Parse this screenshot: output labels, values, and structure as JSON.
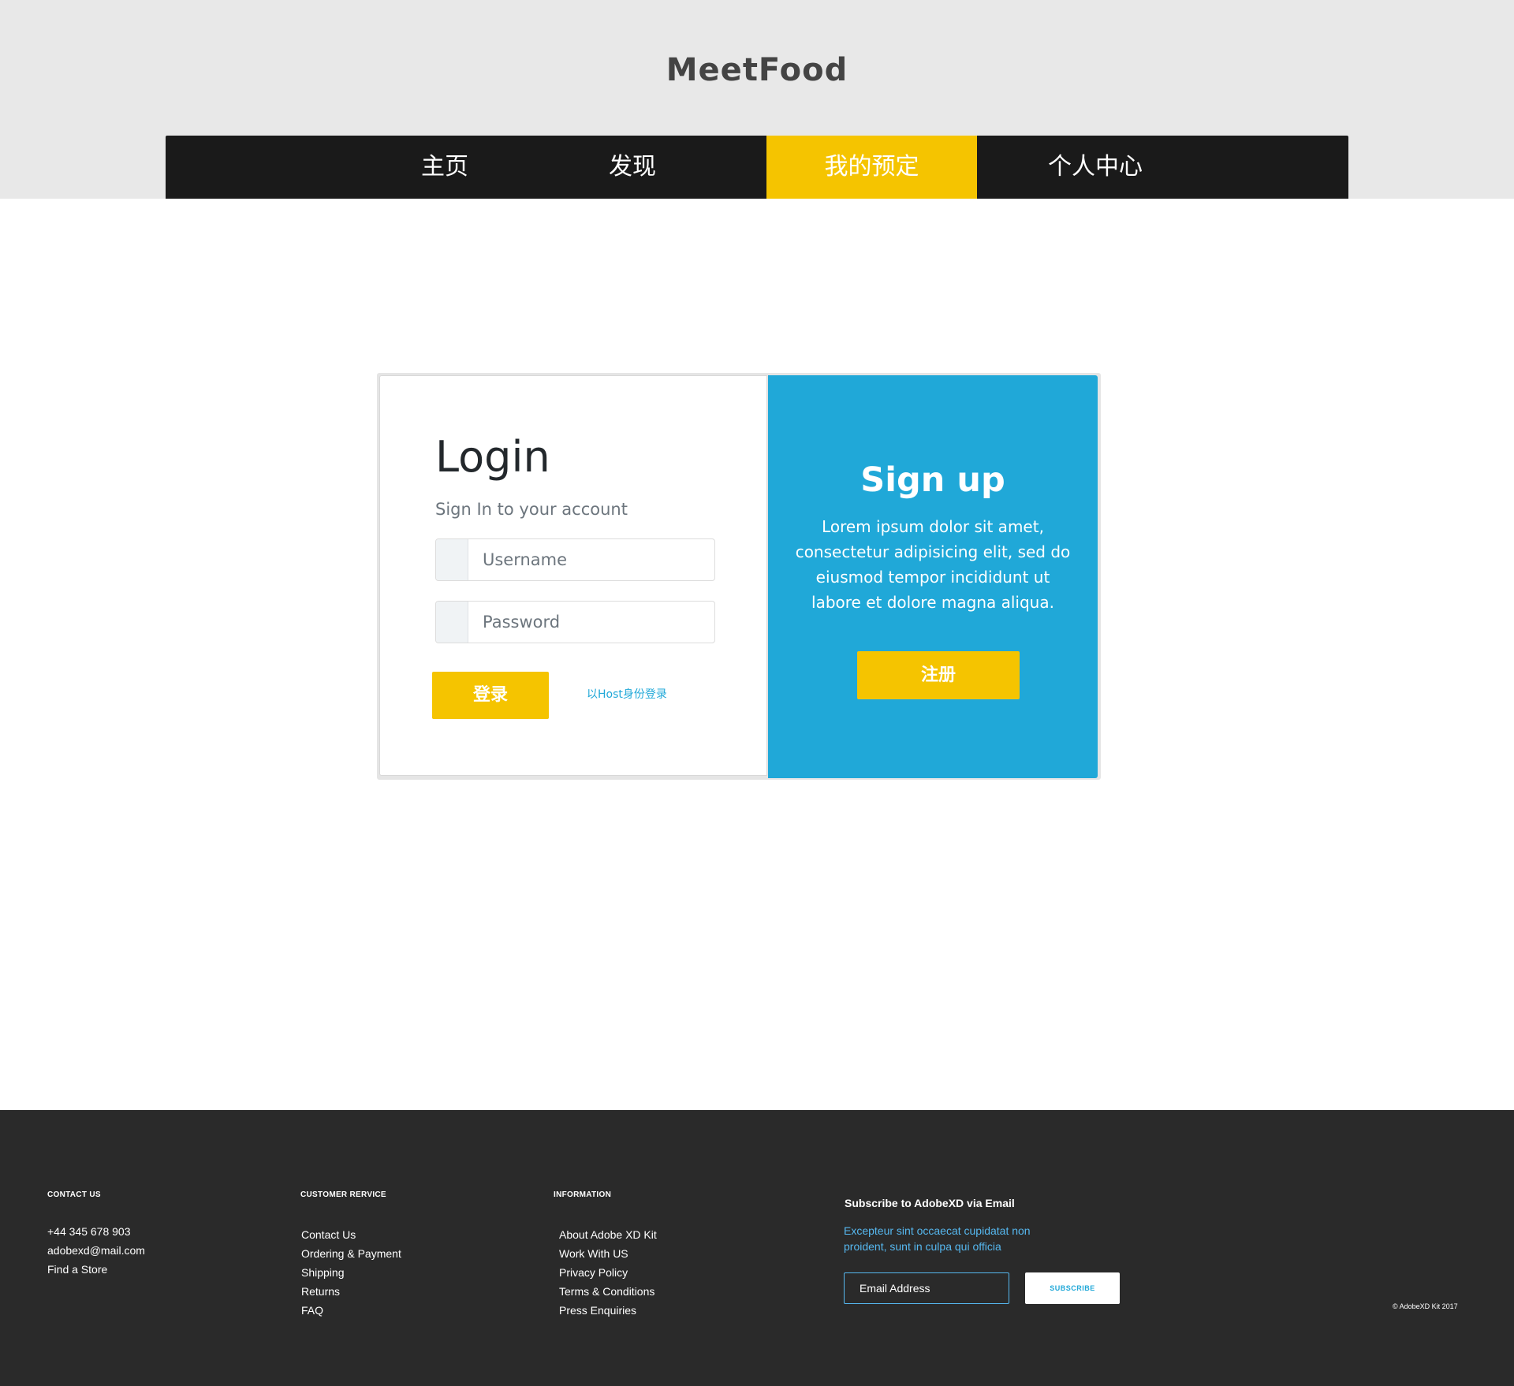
{
  "brand": "MeetFood",
  "nav": {
    "items": [
      {
        "label": "主页"
      },
      {
        "label": "发现"
      },
      {
        "label": "我的预定"
      },
      {
        "label": "个人中心"
      }
    ],
    "active_index": 2
  },
  "login": {
    "title": "Login",
    "subtitle": "Sign In to your account",
    "username_placeholder": "Username",
    "password_placeholder": "Password",
    "submit_label": "登录",
    "host_login_label": "以Host身份登录"
  },
  "signup": {
    "title": "Sign up",
    "text": "Lorem ipsum dolor sit amet, consectetur adipisicing elit, sed do eiusmod tempor incididunt ut labore et dolore magna aliqua.",
    "button_label": "注册"
  },
  "footer": {
    "contact": {
      "heading": "CONTACT US",
      "items": [
        "+44 345 678 903",
        "adobexd@mail.com",
        "Find a Store"
      ]
    },
    "customer_service": {
      "heading": "CUSTOMER RERVICE",
      "items": [
        "Contact Us",
        "Ordering & Payment",
        "Shipping",
        "Returns",
        "FAQ"
      ]
    },
    "information": {
      "heading": "INFORMATION",
      "items": [
        "About Adobe XD Kit",
        "Work With US",
        "Privacy Policy",
        "Terms & Conditions",
        "Press Enquiries"
      ]
    },
    "subscribe": {
      "heading": "Subscribe to AdobeXD via Email",
      "text": "Excepteur sint occaecat cupidatat non proident, sunt in culpa qui officia",
      "email_placeholder": "Email Address",
      "button_label": "SUBSCRIBE"
    },
    "copyright": "© AdobeXD Kit 2017"
  },
  "colors": {
    "header_bg": "#e8e8e8",
    "nav_bg": "#1a1a1a",
    "accent_yellow": "#f5c400",
    "accent_blue": "#20a8d8",
    "footer_bg": "#2a2a2a"
  }
}
